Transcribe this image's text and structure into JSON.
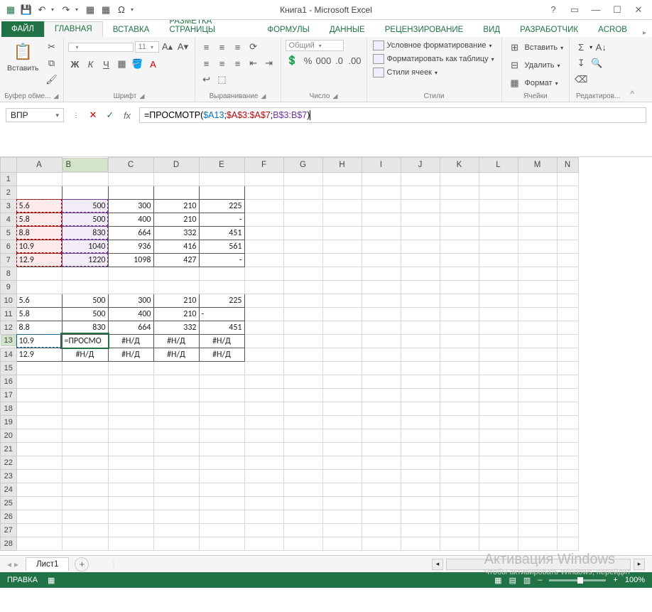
{
  "title": "Книга1 - Microsoft Excel",
  "tabs": {
    "file": "ФАЙЛ",
    "home": "ГЛАВНАЯ",
    "insert": "ВСТАВКА",
    "layout": "РАЗМЕТКА СТРАНИЦЫ",
    "formulas": "ФОРМУЛЫ",
    "data": "ДАННЫЕ",
    "review": "РЕЦЕНЗИРОВАНИЕ",
    "view": "ВИД",
    "dev": "РАЗРАБОТЧИК",
    "acrob": "ACROB"
  },
  "ribbon": {
    "clipboard": {
      "paste": "Вставить",
      "label": "Буфер обме..."
    },
    "font": {
      "size": "11",
      "bold": "Ж",
      "italic": "К",
      "underline": "Ч",
      "label": "Шрифт"
    },
    "align": {
      "label": "Выравнивание"
    },
    "number": {
      "format": "Общий",
      "label": "Число"
    },
    "styles": {
      "cond": "Условное форматирование",
      "fmt_table": "Форматировать как таблицу",
      "cell_styles": "Стили ячеек",
      "label": "Стили"
    },
    "cells": {
      "insert": "Вставить",
      "delete": "Удалить",
      "format": "Формат",
      "label": "Ячейки"
    },
    "edit": {
      "label": "Редактиров..."
    }
  },
  "namebox": "ВПР",
  "formula": {
    "pre": "=ПРОСМОТР(",
    "a1": "$A13",
    "sep1": ";",
    "a2": "$A$3:$A$7",
    "sep2": ";",
    "a3": "B$3:B$7",
    "post": ")"
  },
  "cols": [
    "A",
    "B",
    "C",
    "D",
    "E",
    "F",
    "G",
    "H",
    "I",
    "J",
    "K",
    "L",
    "M",
    "N"
  ],
  "rows": 28,
  "data": {
    "r3": {
      "A": "5.6",
      "B": "500",
      "C": "300",
      "D": "210",
      "E": "225"
    },
    "r4": {
      "A": "5.8",
      "B": "500",
      "C": "400",
      "D": "210",
      "E": "-"
    },
    "r5": {
      "A": "8.8",
      "B": "830",
      "C": "664",
      "D": "332",
      "E": "451"
    },
    "r6": {
      "A": "10.9",
      "B": "1040",
      "C": "936",
      "D": "416",
      "E": "561"
    },
    "r7": {
      "A": "12.9",
      "B": "1220",
      "C": "1098",
      "D": "427",
      "E": "-"
    },
    "r10": {
      "A": "5.6",
      "B": "500",
      "C": "300",
      "D": "210",
      "E": "225"
    },
    "r11": {
      "A": "5.8",
      "B": "500",
      "C": "400",
      "D": "210",
      "E": "-"
    },
    "r12": {
      "A": "8.8",
      "B": "830",
      "C": "664",
      "D": "332",
      "E": "451"
    },
    "r13": {
      "A": "10.9",
      "B": "=ПРОСМО",
      "C": "#Н/Д",
      "D": "#Н/Д",
      "E": "#Н/Д"
    },
    "r14": {
      "A": "12.9",
      "B": "#Н/Д",
      "C": "#Н/Д",
      "D": "#Н/Д",
      "E": "#Н/Д"
    }
  },
  "sheet": {
    "name": "Лист1"
  },
  "status": {
    "mode": "ПРАВКА",
    "zoom": "100%"
  },
  "watermark": {
    "title": "Активация Windows",
    "sub": "Чтобы активировать Windows, перейдит"
  }
}
